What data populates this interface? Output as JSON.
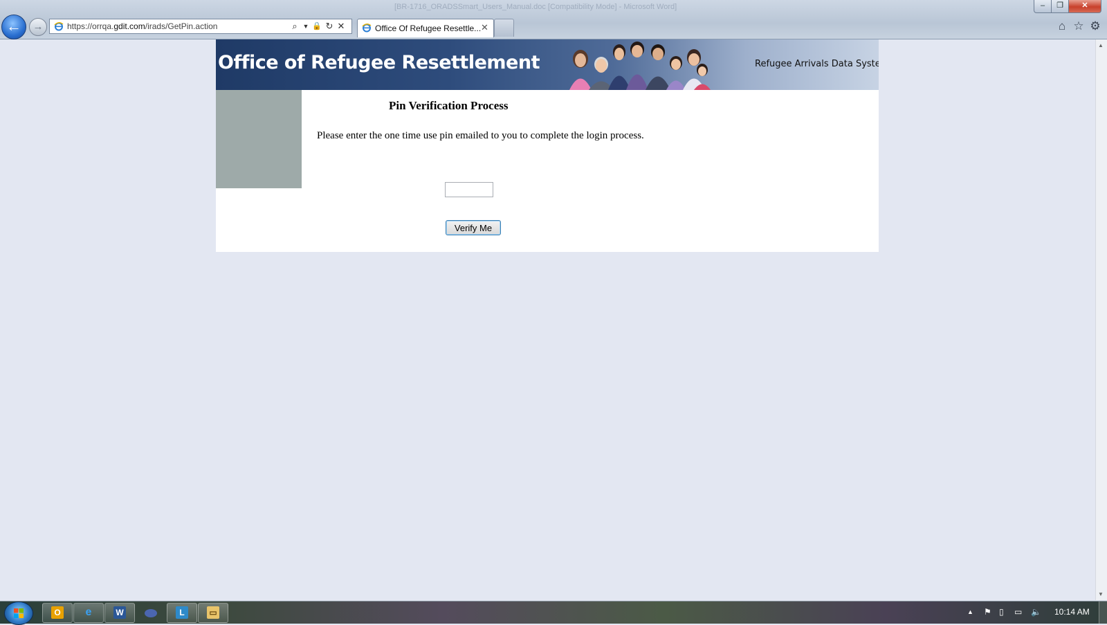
{
  "browser": {
    "window_title": "[BR-1716_ORADSSmart_Users_Manual.doc [Compatibility Mode] - Microsoft Word]",
    "url_prefix": "https://orrqa.",
    "url_domain": "gdit.com",
    "url_path": "/irads/GetPin.action",
    "tab_label": "Office Of Refugee Resettle...",
    "close_glyph": "✕",
    "min_glyph": "–",
    "max_glyph": "❐",
    "back_glyph": "←",
    "fwd_glyph": "→",
    "search_glyph": "⌕",
    "lock_glyph": "🔒",
    "refresh_glyph": "↻",
    "stop_glyph": "✕",
    "home_glyph": "⌂",
    "fav_glyph": "☆",
    "gear_glyph": "⚙"
  },
  "banner": {
    "title": "Office of Refugee Resettlement",
    "subtitle": "Refugee Arrivals Data System"
  },
  "pin_form": {
    "title": "Pin Verification Process",
    "instructions": "Please enter the one time use pin emailed to you to complete the login process.",
    "pin_value": "",
    "verify_label": "Verify Me"
  },
  "taskbar": {
    "clock": "10:14 AM",
    "apps": [
      "outlook-icon",
      "internet-explorer-icon",
      "word-icon",
      "lync-icon",
      "lync-2-icon",
      "file-explorer-icon"
    ],
    "tray_up": "▲"
  },
  "colors": {
    "page_bg": "#e3e7f2",
    "banner_dark": "#1f3a66",
    "sidebar": "#9eaaa9"
  }
}
